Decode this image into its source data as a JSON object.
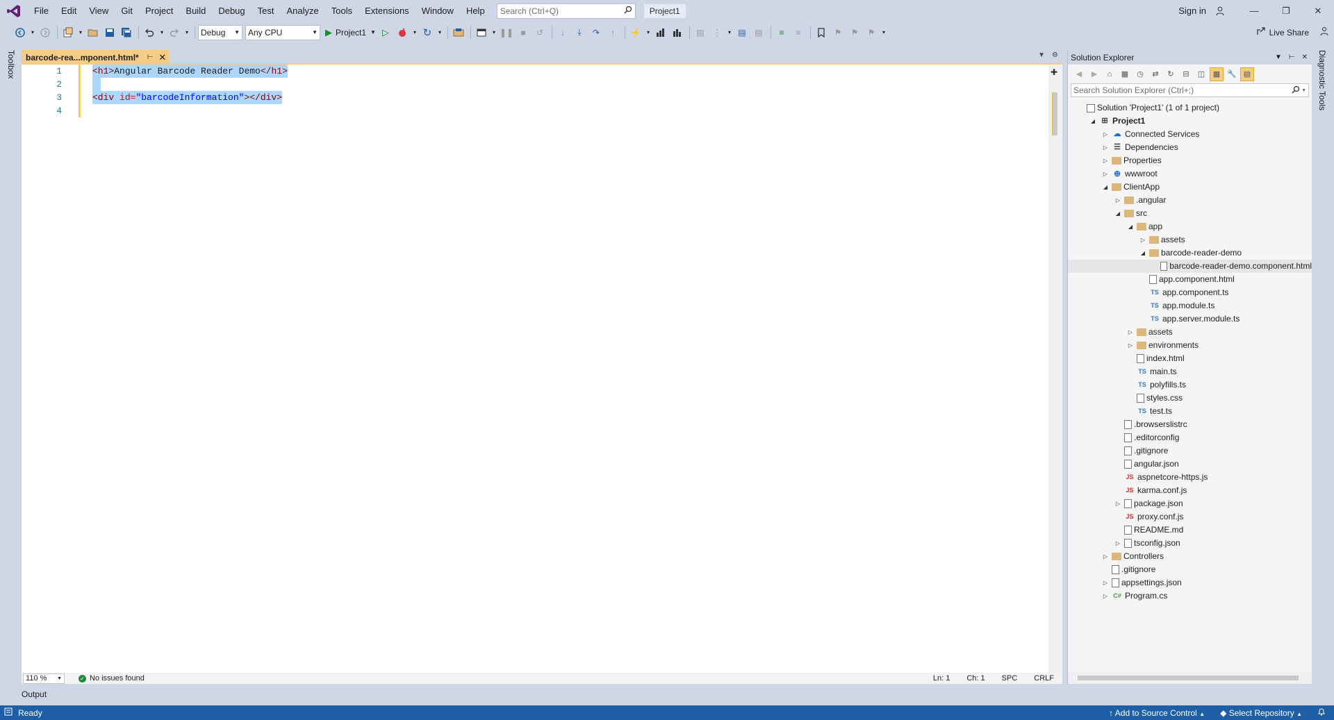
{
  "menu": [
    "File",
    "Edit",
    "View",
    "Git",
    "Project",
    "Build",
    "Debug",
    "Test",
    "Analyze",
    "Tools",
    "Extensions",
    "Window",
    "Help"
  ],
  "search": {
    "placeholder": "Search (Ctrl+Q)"
  },
  "project_name": "Project1",
  "sign_in": "Sign in",
  "toolbar": {
    "config": "Debug",
    "platform": "Any CPU",
    "run_target": "Project1",
    "live_share": "Live Share"
  },
  "side_labels": {
    "toolbox": "Toolbox",
    "diagnostic": "Diagnostic Tools"
  },
  "doc_tab": {
    "title": "barcode-rea...mponent.html*"
  },
  "editor": {
    "line_numbers": [
      "1",
      "2",
      "3",
      "4"
    ],
    "line1": {
      "open": "<h1>",
      "text": "Angular Barcode Reader Demo",
      "close": "</h1>"
    },
    "line3": {
      "open": "<div",
      "attr": " id=",
      "val": "\"barcodeInformation\"",
      "close": "></div>"
    },
    "zoom": "110 %",
    "issues": "No issues found",
    "ln": "Ln: 1",
    "ch": "Ch: 1",
    "spc": "SPC",
    "eol": "CRLF"
  },
  "output_tab": "Output",
  "solution_explorer": {
    "title": "Solution Explorer",
    "search_placeholder": "Search Solution Explorer (Ctrl+;)",
    "items": [
      {
        "label": "Solution 'Project1' (1 of 1 project)",
        "icon": "solution-icon",
        "exp": ""
      },
      {
        "label": "Project1",
        "icon": "project-icon",
        "exp": "down"
      },
      {
        "label": "Connected Services",
        "icon": "connected-services-icon",
        "exp": "right"
      },
      {
        "label": "Dependencies",
        "icon": "dependencies-icon",
        "exp": "right"
      },
      {
        "label": "Properties",
        "icon": "folder-icon",
        "exp": "right"
      },
      {
        "label": "wwwroot",
        "icon": "globe-icon",
        "exp": "right"
      },
      {
        "label": "ClientApp",
        "icon": "folder-icon",
        "exp": "down"
      },
      {
        "label": ".angular",
        "icon": "folder-icon",
        "exp": "right"
      },
      {
        "label": "src",
        "icon": "folder-icon",
        "exp": "down"
      },
      {
        "label": "app",
        "icon": "folder-icon",
        "exp": "down"
      },
      {
        "label": "assets",
        "icon": "folder-icon",
        "exp": "right"
      },
      {
        "label": "barcode-reader-demo",
        "icon": "folder-icon",
        "exp": "down"
      },
      {
        "label": "barcode-reader-demo.component.html",
        "icon": "html-file-icon",
        "exp": ""
      },
      {
        "label": "app.component.html",
        "icon": "html-file-icon",
        "exp": ""
      },
      {
        "label": "app.component.ts",
        "icon": "ts-file-icon",
        "exp": ""
      },
      {
        "label": "app.module.ts",
        "icon": "ts-file-icon",
        "exp": ""
      },
      {
        "label": "app.server.module.ts",
        "icon": "ts-file-icon",
        "exp": ""
      },
      {
        "label": "assets",
        "icon": "folder-icon",
        "exp": "right"
      },
      {
        "label": "environments",
        "icon": "folder-icon",
        "exp": "right"
      },
      {
        "label": "index.html",
        "icon": "html-file-icon",
        "exp": ""
      },
      {
        "label": "main.ts",
        "icon": "ts-file-icon",
        "exp": ""
      },
      {
        "label": "polyfills.ts",
        "icon": "ts-file-icon",
        "exp": ""
      },
      {
        "label": "styles.css",
        "icon": "css-file-icon",
        "exp": ""
      },
      {
        "label": "test.ts",
        "icon": "ts-file-icon",
        "exp": ""
      },
      {
        "label": ".browserslistrc",
        "icon": "file-icon",
        "exp": ""
      },
      {
        "label": ".editorconfig",
        "icon": "file-icon",
        "exp": ""
      },
      {
        "label": ".gitignore",
        "icon": "file-icon",
        "exp": ""
      },
      {
        "label": "angular.json",
        "icon": "json-file-icon",
        "exp": ""
      },
      {
        "label": "aspnetcore-https.js",
        "icon": "js-file-icon",
        "exp": ""
      },
      {
        "label": "karma.conf.js",
        "icon": "js-file-icon",
        "exp": ""
      },
      {
        "label": "package.json",
        "icon": "json-file-icon",
        "exp": "right"
      },
      {
        "label": "proxy.conf.js",
        "icon": "js-file-icon",
        "exp": ""
      },
      {
        "label": "README.md",
        "icon": "md-file-icon",
        "exp": ""
      },
      {
        "label": "tsconfig.json",
        "icon": "json-file-icon",
        "exp": "right"
      },
      {
        "label": "Controllers",
        "icon": "folder-icon",
        "exp": "right"
      },
      {
        "label": ".gitignore",
        "icon": "file-icon",
        "exp": ""
      },
      {
        "label": "appsettings.json",
        "icon": "json-file-icon",
        "exp": "right"
      },
      {
        "label": "Program.cs",
        "icon": "cs-file-icon",
        "exp": "right"
      }
    ]
  },
  "statusbar": {
    "ready": "Ready",
    "source_control": "Add to Source Control",
    "repo": "Select Repository"
  },
  "colors": {
    "accent": "#1e5fa5",
    "tab_active": "#f5cc84",
    "selection": "#add6ff",
    "chrome": "#cfd6e5"
  }
}
